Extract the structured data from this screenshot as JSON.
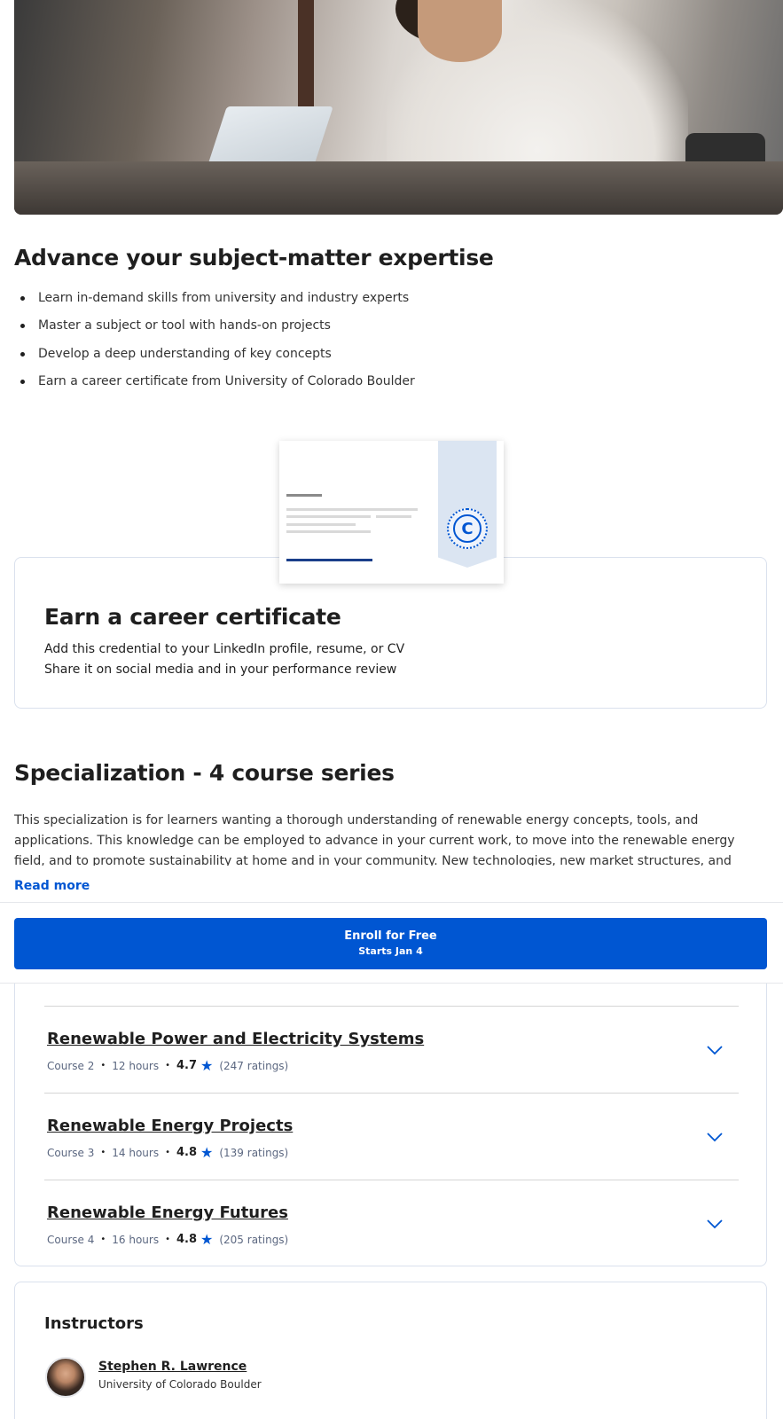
{
  "expertise": {
    "title": "Advance your subject-matter expertise",
    "bullets": [
      "Learn in-demand skills from university and industry experts",
      "Master a subject or tool with hands-on projects",
      "Develop a deep understanding of key concepts",
      "Earn a career certificate from University of Colorado Boulder"
    ]
  },
  "certificate": {
    "title": "Earn a career certificate",
    "line1": "Add this credential to your LinkedIn profile, resume, or CV",
    "line2": "Share it on social media and in your performance review",
    "seal_letter": "C"
  },
  "specialization": {
    "title": "Specialization - 4 course series",
    "description": "This specialization is for learners wanting a thorough understanding of renewable energy concepts, tools, and applications. This knowledge can be employed to advance in your current work, to move into the renewable energy field, and to promote sustainability at home and in your community. New technologies, new market structures, and new business models make",
    "read_more": "Read more"
  },
  "enroll": {
    "label": "Enroll for Free",
    "sub": "Starts Jan 4"
  },
  "courses": [
    {
      "title": "Renewable Power and Electricity Systems",
      "course": "Course 2",
      "hours": "12 hours",
      "rating": "4.7",
      "ratings": "(247 ratings)"
    },
    {
      "title": "Renewable Energy Projects",
      "course": "Course 3",
      "hours": "14 hours",
      "rating": "4.8",
      "ratings": "(139 ratings)"
    },
    {
      "title": "Renewable Energy Futures",
      "course": "Course 4",
      "hours": "16 hours",
      "rating": "4.8",
      "ratings": "(205 ratings)"
    }
  ],
  "instructors": {
    "title": "Instructors",
    "list": [
      {
        "name": "Stephen R. Lawrence",
        "org": "University of Colorado Boulder"
      }
    ]
  },
  "colors": {
    "accent": "#0056d2",
    "border": "#dae1ed"
  },
  "icons": {
    "star": "star-icon",
    "chevron": "chevron-down-icon"
  }
}
